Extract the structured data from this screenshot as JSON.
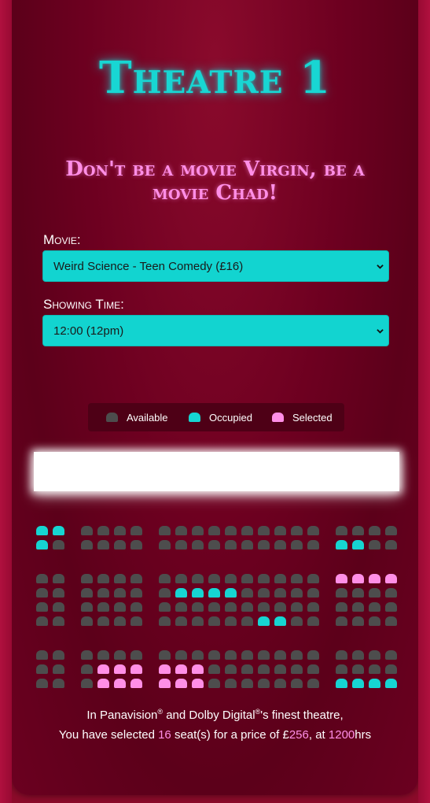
{
  "header": {
    "title": "Theatre 1",
    "tagline": "Don't be a movie Virgin, be a movie Chad!"
  },
  "form": {
    "movie_label": "Movie:",
    "movie_selected": "Weird Science - Teen Comedy (£16)",
    "time_label": "Showing Time:",
    "time_selected": "12:00 (12pm)"
  },
  "legend": {
    "available": "Available",
    "occupied": "Occupied",
    "selected": "Selected"
  },
  "colors": {
    "background": "#6d0020",
    "accent_cyan": "#16d5d2",
    "accent_pink": "#ff8fe6",
    "seat_available": "#4d4d4d"
  },
  "seating": {
    "blocks": [
      [
        [
          "O",
          "O",
          "A",
          "A",
          "A",
          "A",
          "A",
          "A",
          "A",
          "A",
          "A",
          "A",
          "A",
          "A",
          "A",
          "A",
          "A",
          "A",
          "A",
          "A"
        ],
        [
          "O",
          "A",
          "A",
          "A",
          "A",
          "A",
          "A",
          "A",
          "A",
          "A",
          "A",
          "A",
          "A",
          "A",
          "A",
          "A",
          "O",
          "O",
          "A",
          "A"
        ]
      ],
      [
        [
          "A",
          "A",
          "A",
          "A",
          "A",
          "A",
          "A",
          "A",
          "A",
          "A",
          "A",
          "A",
          "A",
          "A",
          "A",
          "A",
          "S",
          "S",
          "S",
          "S"
        ],
        [
          "A",
          "A",
          "A",
          "A",
          "A",
          "A",
          "A",
          "O",
          "O",
          "O",
          "O",
          "A",
          "A",
          "A",
          "A",
          "A",
          "A",
          "A",
          "A",
          "A"
        ],
        [
          "A",
          "A",
          "A",
          "A",
          "A",
          "A",
          "A",
          "A",
          "A",
          "A",
          "A",
          "A",
          "A",
          "A",
          "A",
          "A",
          "A",
          "A",
          "A",
          "A"
        ],
        [
          "A",
          "A",
          "A",
          "A",
          "A",
          "A",
          "A",
          "A",
          "A",
          "A",
          "A",
          "A",
          "O",
          "O",
          "A",
          "A",
          "A",
          "A",
          "A",
          "A"
        ]
      ],
      [
        [
          "A",
          "A",
          "A",
          "A",
          "A",
          "A",
          "A",
          "A",
          "A",
          "A",
          "A",
          "A",
          "A",
          "A",
          "A",
          "A",
          "A",
          "A",
          "A",
          "A"
        ],
        [
          "A",
          "A",
          "A",
          "S",
          "S",
          "S",
          "S",
          "S",
          "S",
          "A",
          "A",
          "A",
          "A",
          "A",
          "A",
          "A",
          "A",
          "A",
          "A",
          "A"
        ],
        [
          "A",
          "A",
          "A",
          "S",
          "S",
          "S",
          "S",
          "S",
          "S",
          "A",
          "A",
          "A",
          "A",
          "A",
          "A",
          "A",
          "O",
          "O",
          "O",
          "O"
        ]
      ]
    ]
  },
  "info": {
    "line1_prefix": "In Panavision",
    "reg": "®",
    "line1_mid": " and Dolby Digital",
    "line1_suffix": "'s finest theatre,",
    "line2_prefix": "You have selected ",
    "count": "16",
    "line2_mid": " seat(s) for a price of £",
    "price": "256",
    "line2_at": ", at ",
    "time": "1200",
    "line2_suffix": "hrs"
  }
}
